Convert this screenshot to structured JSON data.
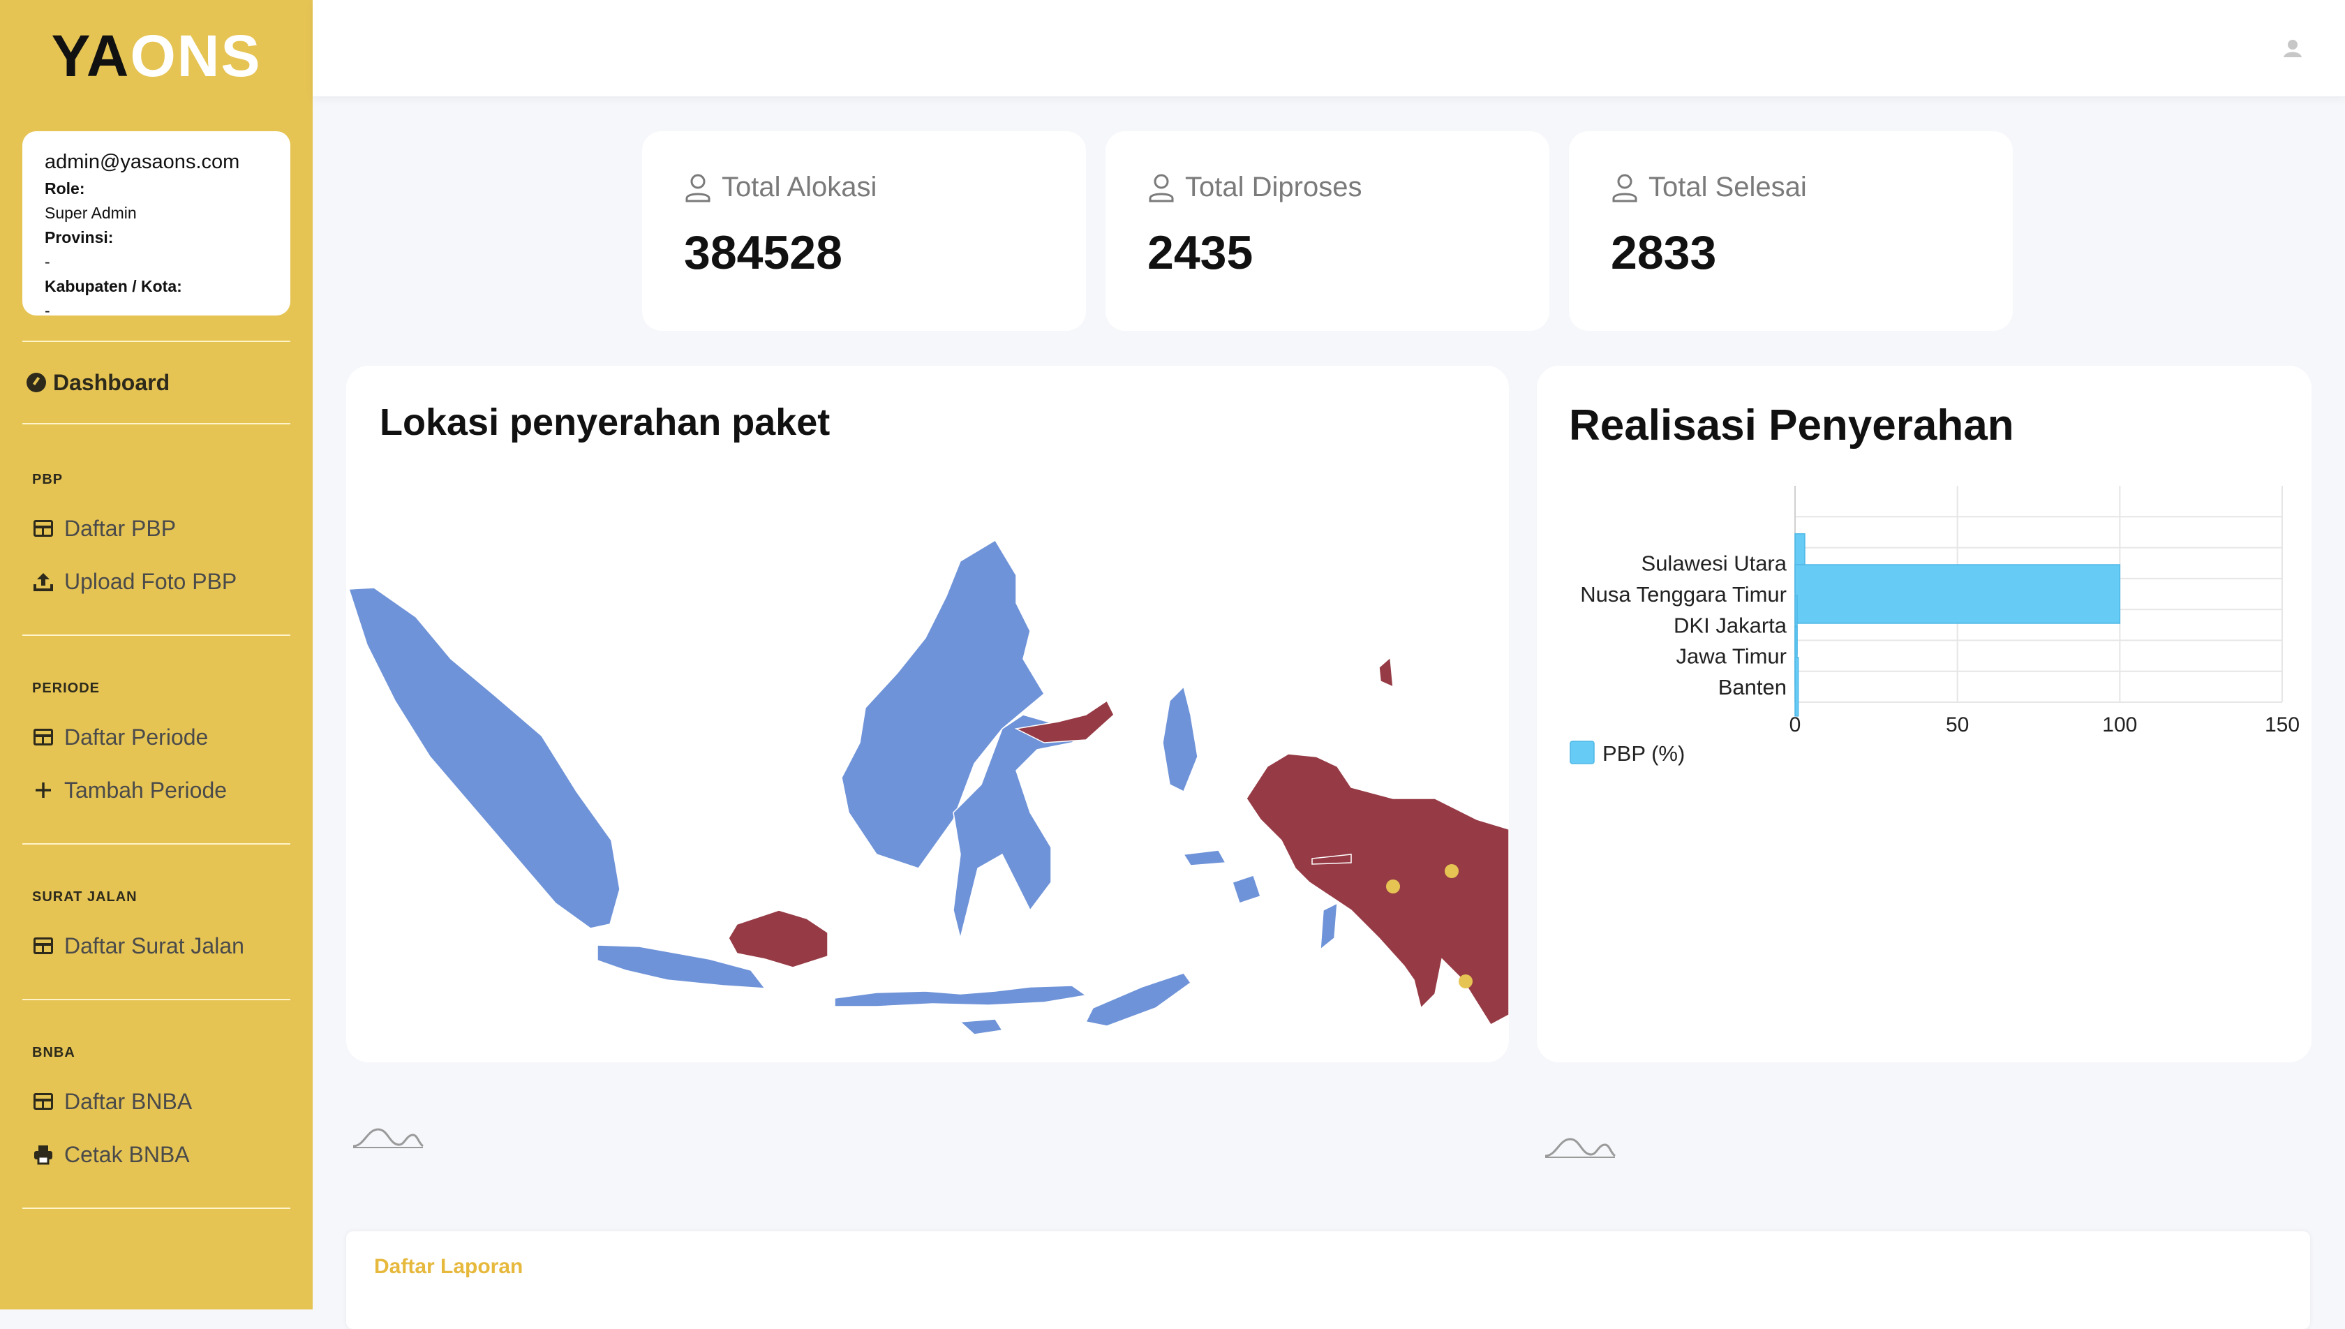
{
  "app": {
    "logo_a": "YA",
    "logo_b": "ONS"
  },
  "user": {
    "email": "admin@yasaons.com",
    "role_label": "Role:",
    "role": "Super Admin",
    "province_label": "Provinsi:",
    "province": "-",
    "city_label": "Kabupaten / Kota:",
    "city": "-"
  },
  "nav": {
    "dashboard": "Dashboard",
    "sections": [
      {
        "title": "PBP",
        "items": [
          "Daftar PBP",
          "Upload Foto PBP"
        ]
      },
      {
        "title": "PERIODE",
        "items": [
          "Daftar Periode",
          "Tambah Periode"
        ]
      },
      {
        "title": "SURAT JALAN",
        "items": [
          "Daftar Surat Jalan"
        ]
      },
      {
        "title": "BNBA",
        "items": [
          "Daftar BNBA",
          "Cetak BNBA"
        ]
      }
    ]
  },
  "stats": [
    {
      "label": "Total Alokasi",
      "value": "384528"
    },
    {
      "label": "Total Diproses",
      "value": "2435"
    },
    {
      "label": "Total Selesai",
      "value": "2833"
    }
  ],
  "map_card": {
    "title": "Lokasi penyerahan paket"
  },
  "chart_card": {
    "title": "Realisasi Penyerahan"
  },
  "chart_data": {
    "type": "bar",
    "orientation": "horizontal",
    "categories": [
      "",
      "",
      "Sulawesi Utara",
      "Nusa Tenggara Timur",
      "DKI Jakarta",
      "Jawa Timur",
      "Banten"
    ],
    "series": [
      {
        "name": "PBP (%)",
        "values": [
          0,
          0,
          3,
          100,
          0.5,
          0.5,
          1
        ],
        "color": "#66cbf5"
      }
    ],
    "xlim": [
      0,
      150
    ],
    "xticks": [
      0,
      50,
      100,
      150
    ],
    "grid": true,
    "legend": "bottom-left"
  },
  "report": {
    "title": "Daftar Laporan"
  },
  "colors": {
    "sidebar": "#e6c454",
    "highlight_region": "#963b45",
    "region": "#6f93d8",
    "bar": "#66cbf5"
  }
}
